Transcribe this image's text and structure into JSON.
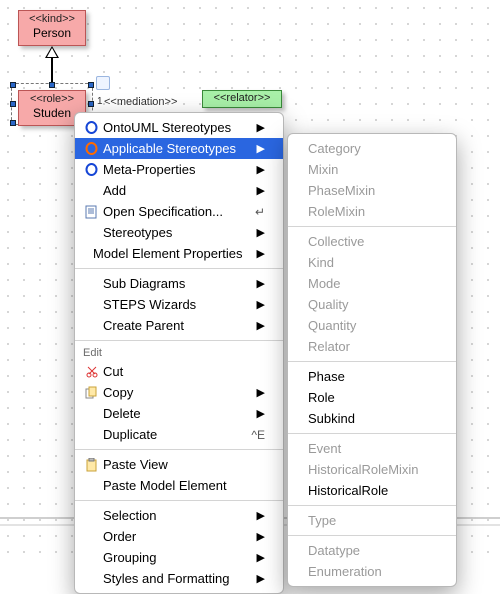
{
  "diagram": {
    "person": {
      "stereo": "<<kind>>",
      "name": "Person"
    },
    "student": {
      "stereo": "<<role>>",
      "name": "Studen"
    },
    "relator": {
      "stereo": "<<relator>>"
    },
    "mediation_label": "<<mediation>>",
    "mult": "1"
  },
  "menu": {
    "ontoUML": "OntoUML Stereotypes",
    "applicable": "Applicable Stereotypes",
    "meta": "Meta-Properties",
    "add": "Add",
    "openSpec": "Open Specification...",
    "stereotypes": "Stereotypes",
    "modelElemProps": "Model Element Properties",
    "subDiagrams": "Sub Diagrams",
    "steps": "STEPS Wizards",
    "createParent": "Create Parent",
    "editLabel": "Edit",
    "cut": "Cut",
    "copy": "Copy",
    "delete": "Delete",
    "duplicate": "Duplicate",
    "dupShortcut": "^E",
    "pasteView": "Paste View",
    "pasteModel": "Paste Model Element",
    "selection": "Selection",
    "order": "Order",
    "grouping": "Grouping",
    "styles": "Styles and Formatting"
  },
  "submenu": {
    "category": "Category",
    "mixin": "Mixin",
    "phaseMixin": "PhaseMixin",
    "roleMixin": "RoleMixin",
    "collective": "Collective",
    "kind": "Kind",
    "mode": "Mode",
    "quality": "Quality",
    "quantity": "Quantity",
    "relator": "Relator",
    "phase": "Phase",
    "role": "Role",
    "subkind": "Subkind",
    "event": "Event",
    "hrmixin": "HistoricalRoleMixin",
    "hrole": "HistoricalRole",
    "type": "Type",
    "datatype": "Datatype",
    "enumeration": "Enumeration"
  }
}
